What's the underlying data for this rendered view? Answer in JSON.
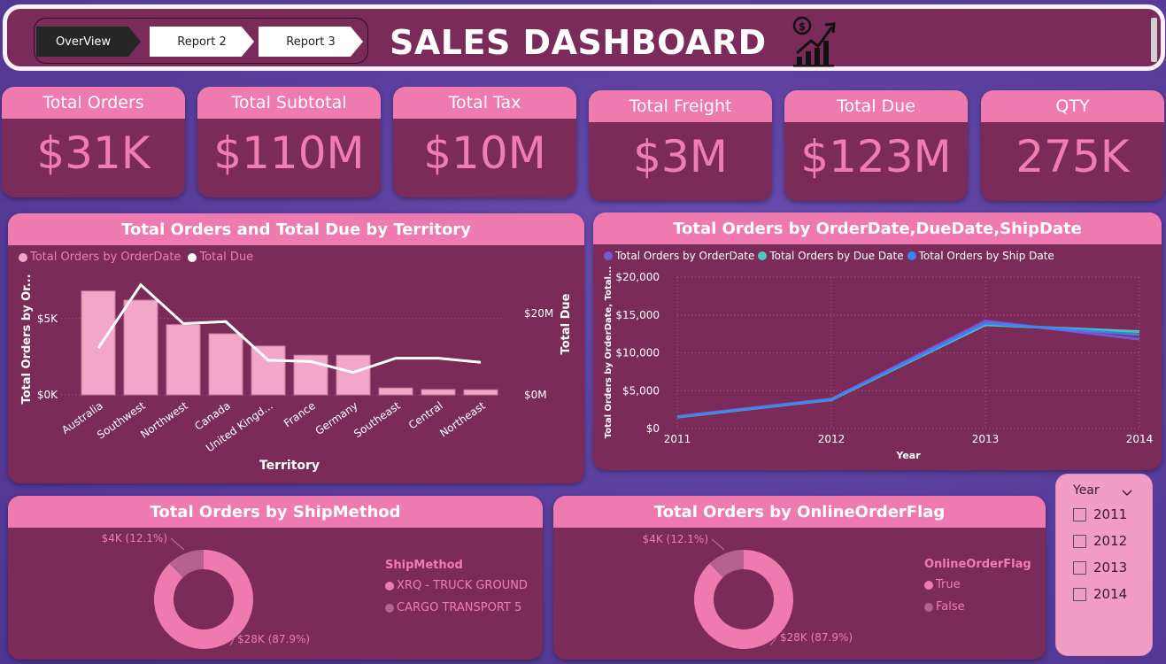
{
  "header": {
    "title": "SALES DASHBOARD",
    "nav": [
      {
        "label": "OverView"
      },
      {
        "label": "Report 2"
      },
      {
        "label": "Report 3"
      }
    ],
    "icon": "chart-growth-dollar-icon"
  },
  "kpis": [
    {
      "label": "Total Orders",
      "value": "$31K"
    },
    {
      "label": "Total Subtotal",
      "value": "$110M"
    },
    {
      "label": "Total Tax",
      "value": "$10M"
    },
    {
      "label": "Total Freight",
      "value": "$3M"
    },
    {
      "label": "Total Due",
      "value": "$123M"
    },
    {
      "label": "QTY",
      "value": "275K"
    }
  ],
  "territory_card": {
    "title": "Total Orders and Total Due by Territory",
    "legend": [
      "Total Orders by OrderDate",
      "Total Due"
    ]
  },
  "date_card": {
    "title": "Total Orders by OrderDate,DueDate,ShipDate",
    "legend": [
      "Total Orders by OrderDate",
      "Total Orders by Due Date",
      "Total Orders by Ship Date"
    ]
  },
  "ship_card": {
    "title": "Total Orders by ShipMethod",
    "legend_title": "ShipMethod",
    "legend": [
      "XRQ - TRUCK GROUND",
      "CARGO TRANSPORT 5"
    ],
    "labels": [
      "$28K (87.9%)",
      "$4K (12.1%)"
    ]
  },
  "online_card": {
    "title": "Total Orders by OnlineOrderFlag",
    "legend_title": "OnlineOrderFlag",
    "legend": [
      "True",
      "False"
    ],
    "labels": [
      "$28K (87.9%)",
      "$4K (12.1%)"
    ]
  },
  "slicer": {
    "title": "Year",
    "items": [
      "2011",
      "2012",
      "2013",
      "2014"
    ]
  },
  "colors": {
    "panel": "#7a2b59",
    "header_pink": "#ef7ab0",
    "bar": "#f2a7c8",
    "line_white": "#ffffff",
    "series_order": "#7b56d6",
    "series_due": "#4ec9c0",
    "series_ship": "#3e82f0",
    "donut_main": "#ef7ab0",
    "donut_minor": "#b5628f"
  },
  "chart_data": [
    {
      "type": "bar",
      "title": "Total Orders and Total Due by Territory",
      "xlabel": "Territory",
      "ylabel": "Total Orders by Or...",
      "y2label": "Total Due",
      "categories": [
        "Australia",
        "Southwest",
        "Northwest",
        "Canada",
        "United Kingd...",
        "France",
        "Germany",
        "Southeast",
        "Central",
        "Northeast"
      ],
      "y_ticks": [
        "$0K",
        "$5K"
      ],
      "y2_ticks": [
        "$0M",
        "$20M"
      ],
      "ylim": [
        0,
        8000
      ],
      "y2lim": [
        0,
        30000000
      ],
      "series": [
        {
          "name": "Total Orders by OrderDate",
          "kind": "bar",
          "values": [
            6800,
            6200,
            4600,
            4000,
            3200,
            2600,
            2600,
            450,
            350,
            330
          ]
        },
        {
          "name": "Total Due",
          "kind": "line",
          "axis": "y2",
          "values": [
            11500000,
            27000000,
            17500000,
            18000000,
            8500000,
            8200000,
            5500000,
            9000000,
            9000000,
            8000000
          ]
        }
      ]
    },
    {
      "type": "line",
      "title": "Total Orders by OrderDate,DueDate,ShipDate",
      "xlabel": "Year",
      "ylabel": "Total Orders by OrderDate, Total...",
      "x": [
        2011,
        2012,
        2013,
        2014
      ],
      "y_ticks": [
        "$0",
        "$5,000",
        "$10,000",
        "$15,000",
        "$20,000"
      ],
      "ylim": [
        0,
        20000
      ],
      "grid": true,
      "series": [
        {
          "name": "Total Orders by OrderDate",
          "values": [
            1600,
            3900,
            14200,
            11800
          ]
        },
        {
          "name": "Total Orders by Due Date",
          "values": [
            1500,
            3800,
            13700,
            12800
          ]
        },
        {
          "name": "Total Orders by Ship Date",
          "values": [
            1550,
            3850,
            13900,
            12400
          ]
        }
      ]
    },
    {
      "type": "pie",
      "title": "Total Orders by ShipMethod",
      "categories": [
        "XRQ - TRUCK GROUND",
        "CARGO TRANSPORT 5"
      ],
      "values": [
        87.9,
        12.1
      ]
    },
    {
      "type": "pie",
      "title": "Total Orders by OnlineOrderFlag",
      "categories": [
        "True",
        "False"
      ],
      "values": [
        87.9,
        12.1
      ]
    }
  ]
}
